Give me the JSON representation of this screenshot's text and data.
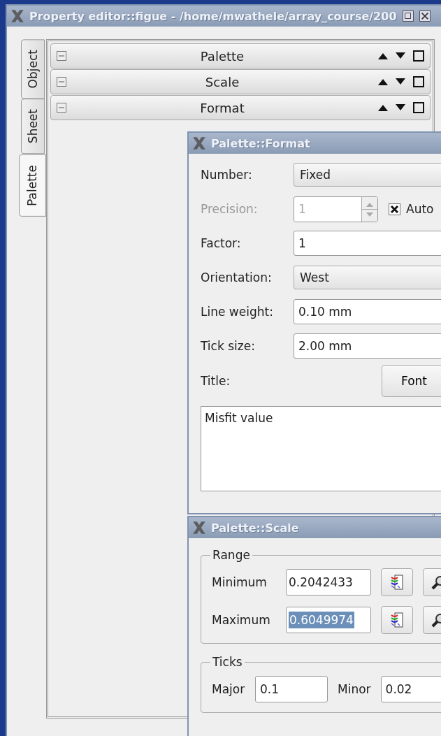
{
  "main_window": {
    "title": "Property editor::figue - /home/mwathele/array_course/200"
  },
  "side_tabs": [
    {
      "label": "Object",
      "selected": false
    },
    {
      "label": "Sheet",
      "selected": false
    },
    {
      "label": "Palette",
      "selected": true
    }
  ],
  "dock_sections": [
    {
      "title": "Palette"
    },
    {
      "title": "Scale"
    },
    {
      "title": "Format"
    }
  ],
  "format_window": {
    "title": "Palette::Format",
    "rows": [
      {
        "kind": "combo",
        "label": "Number:",
        "value": "Fixed",
        "disabled": false
      },
      {
        "kind": "spin",
        "label": "Precision:",
        "value": "1",
        "disabled": true,
        "checkbox": {
          "label": "Auto",
          "checked": true
        }
      },
      {
        "kind": "field",
        "label": "Factor:",
        "value": "1",
        "disabled": false
      },
      {
        "kind": "combo",
        "label": "Orientation:",
        "value": "West",
        "disabled": false
      },
      {
        "kind": "field",
        "label": "Line weight:",
        "value": "0.10 mm",
        "disabled": false
      },
      {
        "kind": "field",
        "label": "Tick size:",
        "value": "2.00 mm",
        "disabled": false
      }
    ],
    "title_label": "Title:",
    "fonts_button": "Font",
    "title_text": "Misfit value"
  },
  "scale_window": {
    "title": "Palette::Scale",
    "range": {
      "legend": "Range",
      "rows": [
        {
          "label": "Minimum",
          "value": "0.2042433",
          "selected": false
        },
        {
          "label": "Maximum",
          "value": "0.6049974",
          "selected": true
        }
      ]
    },
    "ticks": {
      "legend": "Ticks",
      "major_label": "Major",
      "major": "0.1",
      "minor_label": "Minor",
      "minor": "0.02"
    }
  }
}
